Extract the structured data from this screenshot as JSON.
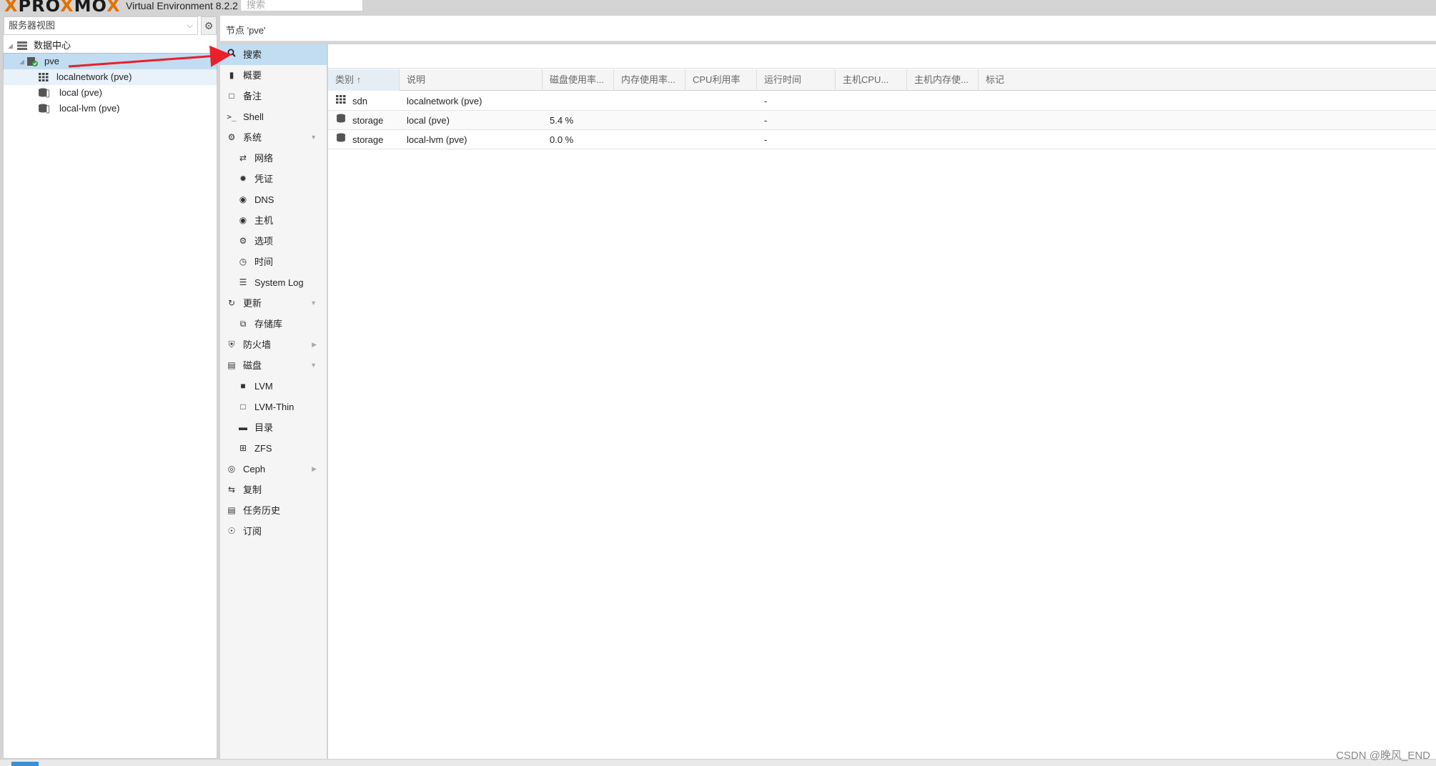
{
  "app": {
    "logo": "PROXMOX",
    "version": "Virtual Environment 8.2.2",
    "search_placeholder": "搜索"
  },
  "tree": {
    "view_select": "服务器视图",
    "nodes": [
      {
        "label": "数据中心",
        "icon": "server-stack-icon"
      },
      {
        "label": "pve",
        "icon": "node-online-icon"
      },
      {
        "label": "localnetwork (pve)",
        "icon": "grid-icon"
      },
      {
        "label": "local (pve)",
        "icon": "storage-icon"
      },
      {
        "label": "local-lvm (pve)",
        "icon": "storage-icon"
      }
    ]
  },
  "content": {
    "title": "节点 'pve'"
  },
  "menu": [
    {
      "label": "搜索",
      "icon": "search-icon",
      "active": true
    },
    {
      "label": "概要",
      "icon": "book-icon"
    },
    {
      "label": "备注",
      "icon": "note-icon"
    },
    {
      "label": "Shell",
      "icon": "terminal-icon"
    },
    {
      "label": "系统",
      "icon": "cogs-icon",
      "expanded": true
    },
    {
      "label": "网络",
      "icon": "exchange-icon"
    },
    {
      "label": "凭证",
      "icon": "certificate-icon"
    },
    {
      "label": "DNS",
      "icon": "globe-icon"
    },
    {
      "label": "主机",
      "icon": "globe-icon"
    },
    {
      "label": "选项",
      "icon": "gear-icon"
    },
    {
      "label": "时间",
      "icon": "clock-icon"
    },
    {
      "label": "System Log",
      "icon": "list-icon"
    },
    {
      "label": "更新",
      "icon": "refresh-icon",
      "expanded": true
    },
    {
      "label": "存储库",
      "icon": "files-icon"
    },
    {
      "label": "防火墙",
      "icon": "shield-icon",
      "collapsed": true
    },
    {
      "label": "磁盘",
      "icon": "hdd-icon",
      "expanded": true
    },
    {
      "label": "LVM",
      "icon": "square-filled-icon"
    },
    {
      "label": "LVM-Thin",
      "icon": "square-outline-icon"
    },
    {
      "label": "目录",
      "icon": "folder-icon"
    },
    {
      "label": "ZFS",
      "icon": "th-large-icon"
    },
    {
      "label": "Ceph",
      "icon": "ceph-icon",
      "collapsed": true
    },
    {
      "label": "复制",
      "icon": "retweet-icon"
    },
    {
      "label": "任务历史",
      "icon": "list-alt-icon"
    },
    {
      "label": "订阅",
      "icon": "support-icon"
    }
  ],
  "grid": {
    "columns": [
      "类别 ↑",
      "说明",
      "磁盘使用率...",
      "内存使用率...",
      "CPU利用率",
      "运行时间",
      "主机CPU...",
      "主机内存使...",
      "标记"
    ],
    "rows": [
      {
        "type": "sdn",
        "icon": "grid-icon",
        "description": "localnetwork (pve)",
        "disk": "",
        "mem": "",
        "cpu": "",
        "uptime": "-",
        "host_cpu": "",
        "host_mem": "",
        "tags": ""
      },
      {
        "type": "storage",
        "icon": "storage-icon",
        "description": "local (pve)",
        "disk": "5.4 %",
        "mem": "",
        "cpu": "",
        "uptime": "-",
        "host_cpu": "",
        "host_mem": "",
        "tags": ""
      },
      {
        "type": "storage",
        "icon": "storage-icon",
        "description": "local-lvm (pve)",
        "disk": "0.0 %",
        "mem": "",
        "cpu": "",
        "uptime": "-",
        "host_cpu": "",
        "host_mem": "",
        "tags": ""
      }
    ]
  },
  "watermark": "CSDN @晚风_END",
  "colors": {
    "accent": "#e57000",
    "selection": "#c2ddf2",
    "annotation": "#e8202a"
  }
}
